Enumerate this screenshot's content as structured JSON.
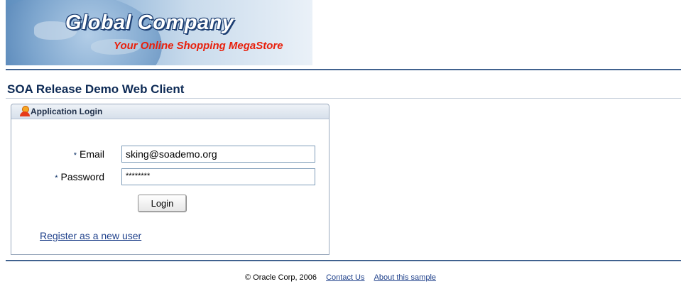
{
  "banner": {
    "company": "Global Company",
    "tagline": "Your Online Shopping MegaStore"
  },
  "page_title": "SOA Release Demo Web Client",
  "login_panel": {
    "header": "Application Login",
    "email_label": "Email",
    "email_value": "sking@soademo.org",
    "password_label": "Password",
    "password_value": "********",
    "required_marker": "*",
    "login_button": "Login",
    "register_link": "Register as a new user"
  },
  "footer": {
    "copyright": "© Oracle Corp, 2006",
    "contact_link": "Contact Us",
    "about_link": "About this sample"
  }
}
